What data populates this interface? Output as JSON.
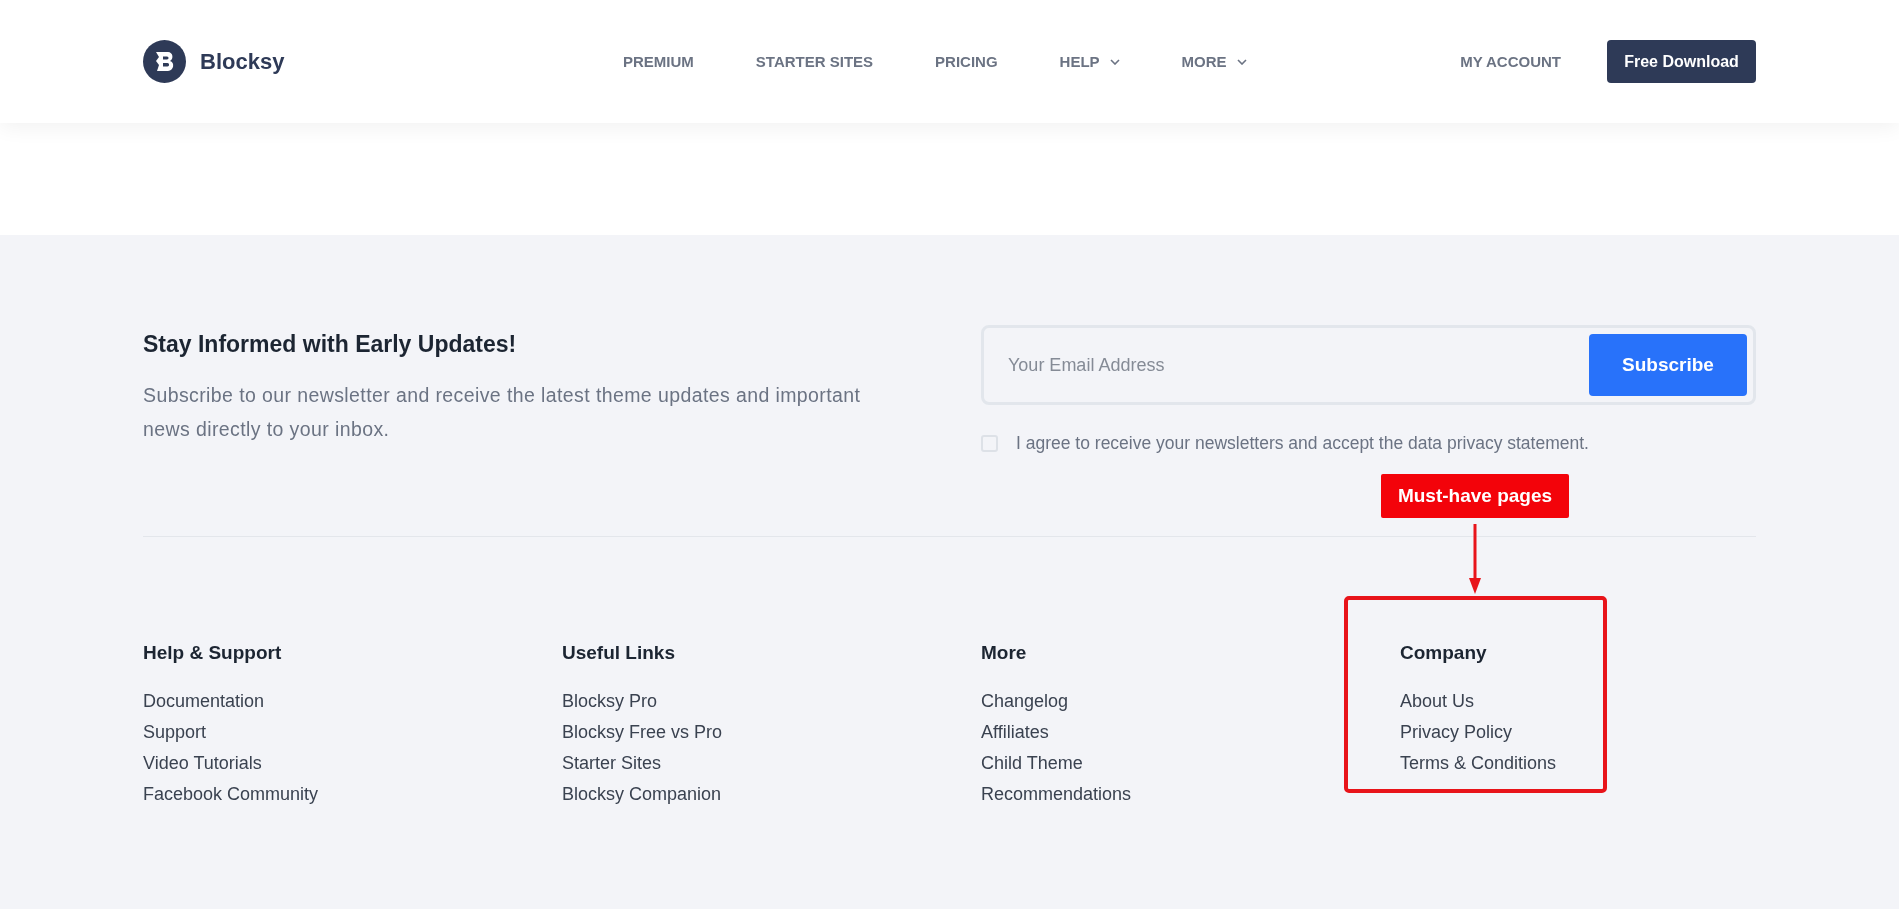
{
  "header": {
    "logo_text": "Blocksy",
    "nav": [
      {
        "label": "PREMIUM",
        "has_dropdown": false
      },
      {
        "label": "STARTER SITES",
        "has_dropdown": false
      },
      {
        "label": "PRICING",
        "has_dropdown": false
      },
      {
        "label": "HELP",
        "has_dropdown": true
      },
      {
        "label": "MORE",
        "has_dropdown": true
      }
    ],
    "account_link": "MY ACCOUNT",
    "download_button": "Free Download"
  },
  "newsletter": {
    "title": "Stay Informed with Early Updates!",
    "description": "Subscribe to our newsletter and receive the latest theme updates and important news directly to your inbox.",
    "email_placeholder": "Your Email Address",
    "subscribe_button": "Subscribe",
    "consent": {
      "label": "I agree to receive your newsletters and accept the data privacy statement.",
      "checked": false
    }
  },
  "footer_columns": [
    {
      "title": "Help & Support",
      "links": [
        "Documentation",
        "Support",
        "Video Tutorials",
        "Facebook Community"
      ],
      "highlighted": false
    },
    {
      "title": "Useful Links",
      "links": [
        "Blocksy Pro",
        "Blocksy Free vs Pro",
        "Starter Sites",
        "Blocksy Companion"
      ],
      "highlighted": false
    },
    {
      "title": "More",
      "links": [
        "Changelog",
        "Affiliates",
        "Child Theme",
        "Recommendations"
      ],
      "highlighted": false
    },
    {
      "title": "Company",
      "links": [
        "About Us",
        "Privacy Policy",
        "Terms & Conditions"
      ],
      "highlighted": true
    }
  ],
  "annotation": {
    "label": "Must-have pages"
  }
}
